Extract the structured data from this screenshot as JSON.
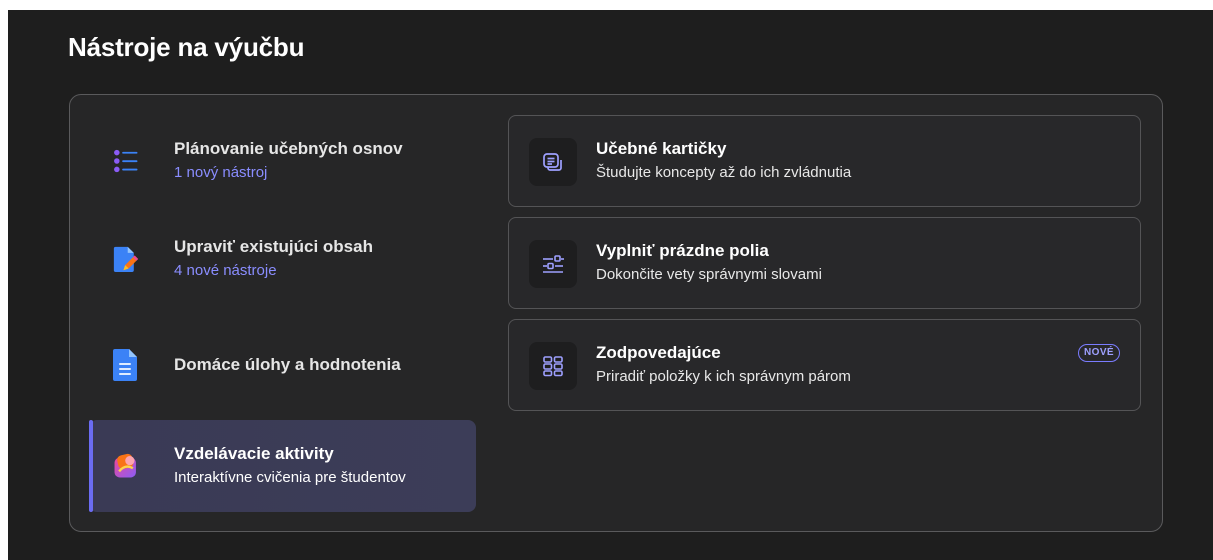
{
  "header": {
    "title": "Nástroje na výučbu"
  },
  "nav": {
    "items": [
      {
        "title": "Plánovanie učebných osnov",
        "subtitle": "1 nový nástroj",
        "icon": "list-icon"
      },
      {
        "title": "Upraviť existujúci obsah",
        "subtitle": "4 nové nástroje",
        "icon": "edit-document-icon"
      },
      {
        "title": "Domáce úlohy a hodnotenia",
        "subtitle": "",
        "icon": "document-icon"
      },
      {
        "title": "Vzdelávacie aktivity",
        "subtitle": "Interaktívne cvičenia pre študentov",
        "icon": "activities-icon"
      }
    ]
  },
  "cards": [
    {
      "title": "Učebné kartičky",
      "description": "Študujte koncepty až do ich zvládnutia",
      "icon": "flashcards-icon"
    },
    {
      "title": "Vyplniť prázdne polia",
      "description": "Dokončite vety správnymi slovami",
      "icon": "fill-blanks-icon"
    },
    {
      "title": "Zodpovedajúce",
      "description": "Priradiť položky k ich správnym párom",
      "icon": "matching-icon",
      "badge": "NOVÉ"
    }
  ],
  "colors": {
    "background": "#1e1e1e",
    "panel": "#262627",
    "accent": "#6b6cf2",
    "link": "#8a8dff"
  }
}
